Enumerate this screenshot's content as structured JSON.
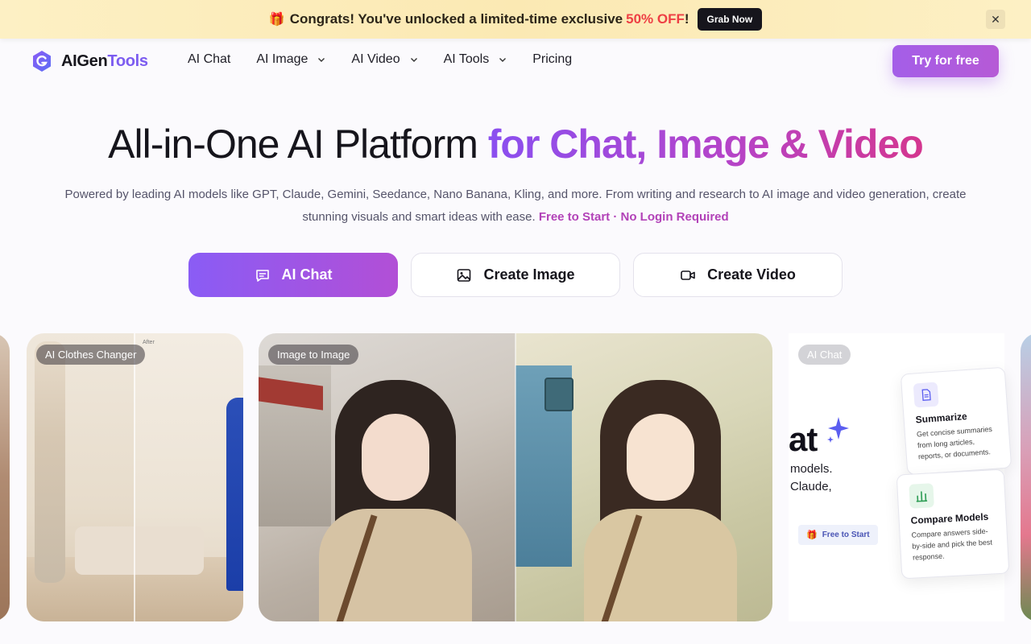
{
  "promo": {
    "gift_icon": "🎁",
    "text_before": "Congrats! You've unlocked a limited-time exclusive",
    "highlight": "50% OFF",
    "text_after": "!",
    "button": "Grab Now",
    "close_icon": "close-icon"
  },
  "nav": {
    "logo_part_a": "AIGen",
    "logo_part_b": "Tools",
    "links": [
      {
        "label": "AI Chat",
        "has_dropdown": false
      },
      {
        "label": "AI Image",
        "has_dropdown": true
      },
      {
        "label": "AI Video",
        "has_dropdown": true
      },
      {
        "label": "AI Tools",
        "has_dropdown": true
      },
      {
        "label": "Pricing",
        "has_dropdown": false
      }
    ],
    "try_button": "Try for free"
  },
  "hero": {
    "title_plain": "All-in-One AI Platform ",
    "title_gradient": "for Chat, Image & Video",
    "subtitle": "Powered by leading AI models like GPT, Claude, Gemini, Seedance, Nano Banana, Kling, and more. From writing and research to AI image and video generation, create stunning visuals and smart ideas with ease.",
    "subtitle_highlight": "Free to Start · No Login Required",
    "cta": [
      {
        "label": "AI Chat",
        "icon": "chat-icon"
      },
      {
        "label": "Create Image",
        "icon": "image-icon"
      },
      {
        "label": "Create Video",
        "icon": "video-icon"
      }
    ]
  },
  "carousel": {
    "cards": [
      {
        "badge": "AI Clothes Changer",
        "after_label": "After"
      },
      {
        "badge": "Image to Image"
      },
      {
        "badge": "AI Chat",
        "title_fragment": "at",
        "line1": "models.",
        "line2": "Claude,",
        "free_pill": "Free to Start",
        "features": [
          {
            "title": "Summarize",
            "desc": "Get concise summaries from long articles, reports, or documents."
          },
          {
            "title": "Compare Models",
            "desc": "Compare answers side-by-side and pick the best response."
          }
        ]
      }
    ]
  },
  "colors": {
    "accent_purple": "#8a5cf5",
    "accent_pink": "#d4368f",
    "promo_red": "#ee3f44"
  }
}
